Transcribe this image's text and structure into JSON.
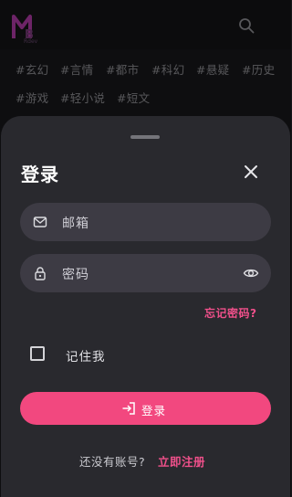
{
  "app": {
    "logo_text": "MB Rdev",
    "icons": {
      "search": "search-icon"
    }
  },
  "tags": [
    "#玄幻",
    "#言情",
    "#都市",
    "#科幻",
    "#悬疑",
    "#历史",
    "#游戏",
    "#轻小说",
    "#短文"
  ],
  "login_sheet": {
    "title": "登录",
    "email": {
      "placeholder": "邮箱",
      "icon": "mail-icon"
    },
    "password": {
      "placeholder": "密码",
      "icon": "lock-icon",
      "toggle_icon": "eye-icon"
    },
    "forgot_password": "忘记密码?",
    "remember_me": {
      "label": "记住我",
      "checked": false
    },
    "login_button": {
      "label": "登录",
      "icon": "login-icon"
    },
    "no_account_text": "还没有账号?",
    "signup_link": "立即注册"
  },
  "colors": {
    "accent": "#f2487f",
    "link": "#f0508b",
    "sheet_bg": "#29292e",
    "field_bg": "#3d3b44"
  }
}
